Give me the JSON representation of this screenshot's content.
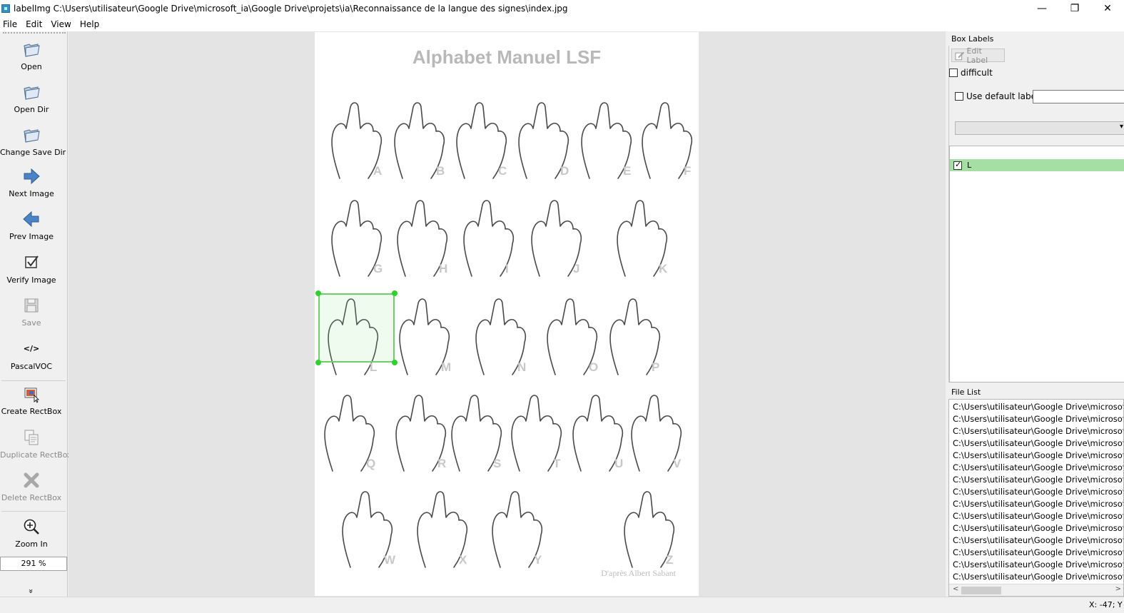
{
  "window": {
    "title": "labelImg C:\\Users\\utilisateur\\Google Drive\\microsoft_ia\\Google Drive\\projets\\ia\\Reconnaissance de la langue des signes\\index.jpg",
    "minimize": "—",
    "restore": "❐",
    "close": "✕"
  },
  "menu": [
    "File",
    "Edit",
    "View",
    "Help"
  ],
  "toolbar": {
    "open": "Open",
    "open_dir": "Open Dir",
    "change_save_dir": "Change Save Dir",
    "next_image": "Next Image",
    "prev_image": "Prev Image",
    "verify_image": "Verify Image",
    "save": "Save",
    "format": "PascalVOC",
    "format_glyph": "</>",
    "create_rectbox": "Create RectBox",
    "duplicate_rectbox": "Duplicate RectBox",
    "delete_rectbox": "Delete RectBox",
    "zoom_in": "Zoom In",
    "zoom_value": "291 %",
    "more": "»"
  },
  "image": {
    "title": "Alphabet Manuel LSF",
    "credit": "D'après Albert Sabant",
    "letters": [
      "A",
      "B",
      "C",
      "D",
      "E",
      "F",
      "G",
      "H",
      "I",
      "J",
      "K",
      "L",
      "M",
      "N",
      "O",
      "P",
      "Q",
      "R",
      "S",
      "T",
      "U",
      "V",
      "W",
      "X",
      "Y",
      "Z"
    ],
    "bbox_label": "L"
  },
  "box_labels": {
    "title": "Box Labels",
    "edit_label": "Edit Label",
    "difficult": "difficult",
    "use_default_label": "Use default label",
    "default_label_value": "",
    "labels": [
      {
        "text": "L",
        "checked": true,
        "color": "#a6dfa4"
      }
    ]
  },
  "file_list": {
    "title": "File List",
    "files": [
      "C:\\Users\\utilisateur\\Google Drive\\microsoft_",
      "C:\\Users\\utilisateur\\Google Drive\\microsoft_",
      "C:\\Users\\utilisateur\\Google Drive\\microsoft_",
      "C:\\Users\\utilisateur\\Google Drive\\microsoft_",
      "C:\\Users\\utilisateur\\Google Drive\\microsoft_",
      "C:\\Users\\utilisateur\\Google Drive\\microsoft_",
      "C:\\Users\\utilisateur\\Google Drive\\microsoft_",
      "C:\\Users\\utilisateur\\Google Drive\\microsoft_",
      "C:\\Users\\utilisateur\\Google Drive\\microsoft_",
      "C:\\Users\\utilisateur\\Google Drive\\microsoft_",
      "C:\\Users\\utilisateur\\Google Drive\\microsoft_",
      "C:\\Users\\utilisateur\\Google Drive\\microsoft_",
      "C:\\Users\\utilisateur\\Google Drive\\microsoft_",
      "C:\\Users\\utilisateur\\Google Drive\\microsoft_",
      "C:\\Users\\utilisateur\\Google Drive\\microsoft_"
    ]
  },
  "status": {
    "text": "X: -47; Y"
  }
}
